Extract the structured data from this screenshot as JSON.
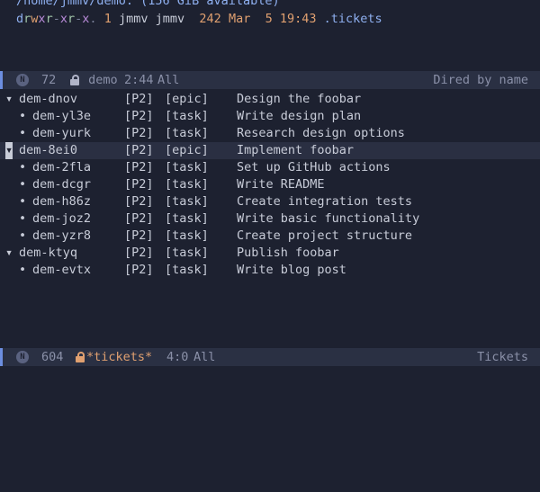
{
  "dired": {
    "path": "/home/jmmv/demo: (156 GiB available)",
    "entry": {
      "perms": [
        "d",
        "r",
        "w",
        "x",
        "r",
        "-",
        "x",
        "r",
        "-",
        "x",
        "."
      ],
      "links": "1",
      "owner": "jmmv",
      "group": "jmmv",
      "size": "242",
      "month": "Mar",
      "day": "5",
      "time": "19:43",
      "name": ".tickets"
    }
  },
  "modeline_top": {
    "badge": "N",
    "line": "72",
    "buffer": "demo",
    "position": "2:44",
    "scroll": "All",
    "mode": "Dired by name"
  },
  "tickets": [
    {
      "marker": "▾",
      "id": "dem-dnov",
      "priority": "[P2]",
      "type": "[epic]",
      "title": "Design the foobar",
      "level": 0
    },
    {
      "marker": "•",
      "id": "dem-yl3e",
      "priority": "[P2]",
      "type": "[task]",
      "title": "Write design plan",
      "level": 1
    },
    {
      "marker": "•",
      "id": "dem-yurk",
      "priority": "[P2]",
      "type": "[task]",
      "title": "Research design options",
      "level": 1
    },
    {
      "marker": "▾",
      "id": "dem-8ei0",
      "priority": "[P2]",
      "type": "[epic]",
      "title": "Implement foobar",
      "level": 0,
      "current": true
    },
    {
      "marker": "•",
      "id": "dem-2fla",
      "priority": "[P2]",
      "type": "[task]",
      "title": "Set up GitHub actions",
      "level": 1
    },
    {
      "marker": "•",
      "id": "dem-dcgr",
      "priority": "[P2]",
      "type": "[task]",
      "title": "Write README",
      "level": 1
    },
    {
      "marker": "•",
      "id": "dem-h86z",
      "priority": "[P2]",
      "type": "[task]",
      "title": "Create integration tests",
      "level": 1
    },
    {
      "marker": "•",
      "id": "dem-joz2",
      "priority": "[P2]",
      "type": "[task]",
      "title": "Write basic functionality",
      "level": 1
    },
    {
      "marker": "•",
      "id": "dem-yzr8",
      "priority": "[P2]",
      "type": "[task]",
      "title": "Create project structure",
      "level": 1
    },
    {
      "marker": "▾",
      "id": "dem-ktyq",
      "priority": "[P2]",
      "type": "[task]",
      "title": "Publish foobar",
      "level": 0
    },
    {
      "marker": "•",
      "id": "dem-evtx",
      "priority": "[P2]",
      "type": "[task]",
      "title": "Write blog post",
      "level": 1
    }
  ],
  "modeline_bottom": {
    "badge": "N",
    "line": "604",
    "buffer": "*tickets*",
    "position": "4:0",
    "scroll": "All",
    "mode": "Tickets"
  },
  "colors": {
    "background": "#1d2130",
    "modeline": "#2a3043",
    "accent": "#6c8ee0",
    "orange": "#e0a070"
  }
}
